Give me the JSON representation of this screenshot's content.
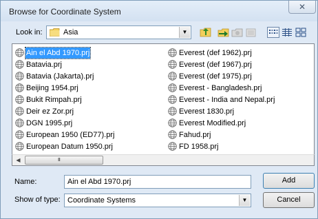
{
  "window": {
    "title": "Browse for Coordinate System",
    "close_label": "✕"
  },
  "look_in": {
    "label": "Look in:",
    "value": "Asia"
  },
  "files_left": [
    "Ain el Abd 1970.prj",
    "Batavia.prj",
    "Batavia (Jakarta).prj",
    "Beijing 1954.prj",
    "Bukit Rimpah.prj",
    "Deir ez Zor.prj",
    "DGN 1995.prj",
    "European 1950 (ED77).prj",
    "European Datum 1950.prj"
  ],
  "files_right": [
    "Everest (def 1962).prj",
    "Everest (def 1967).prj",
    "Everest (def 1975).prj",
    "Everest - Bangladesh.prj",
    "Everest - India and Nepal.prj",
    "Everest 1830.prj",
    "Everest Modified.prj",
    "Fahud.prj",
    "FD 1958.prj"
  ],
  "scrollbar": {
    "grip": "III"
  },
  "name": {
    "label": "Name:",
    "value": "Ain el Abd 1970.prj"
  },
  "show_of_type": {
    "label": "Show of type:",
    "value": "Coordinate Systems"
  },
  "buttons": {
    "add": "Add",
    "cancel": "Cancel"
  },
  "colors": {
    "selection": "#3399ff",
    "dialog_bg": "#dfe9f5"
  }
}
